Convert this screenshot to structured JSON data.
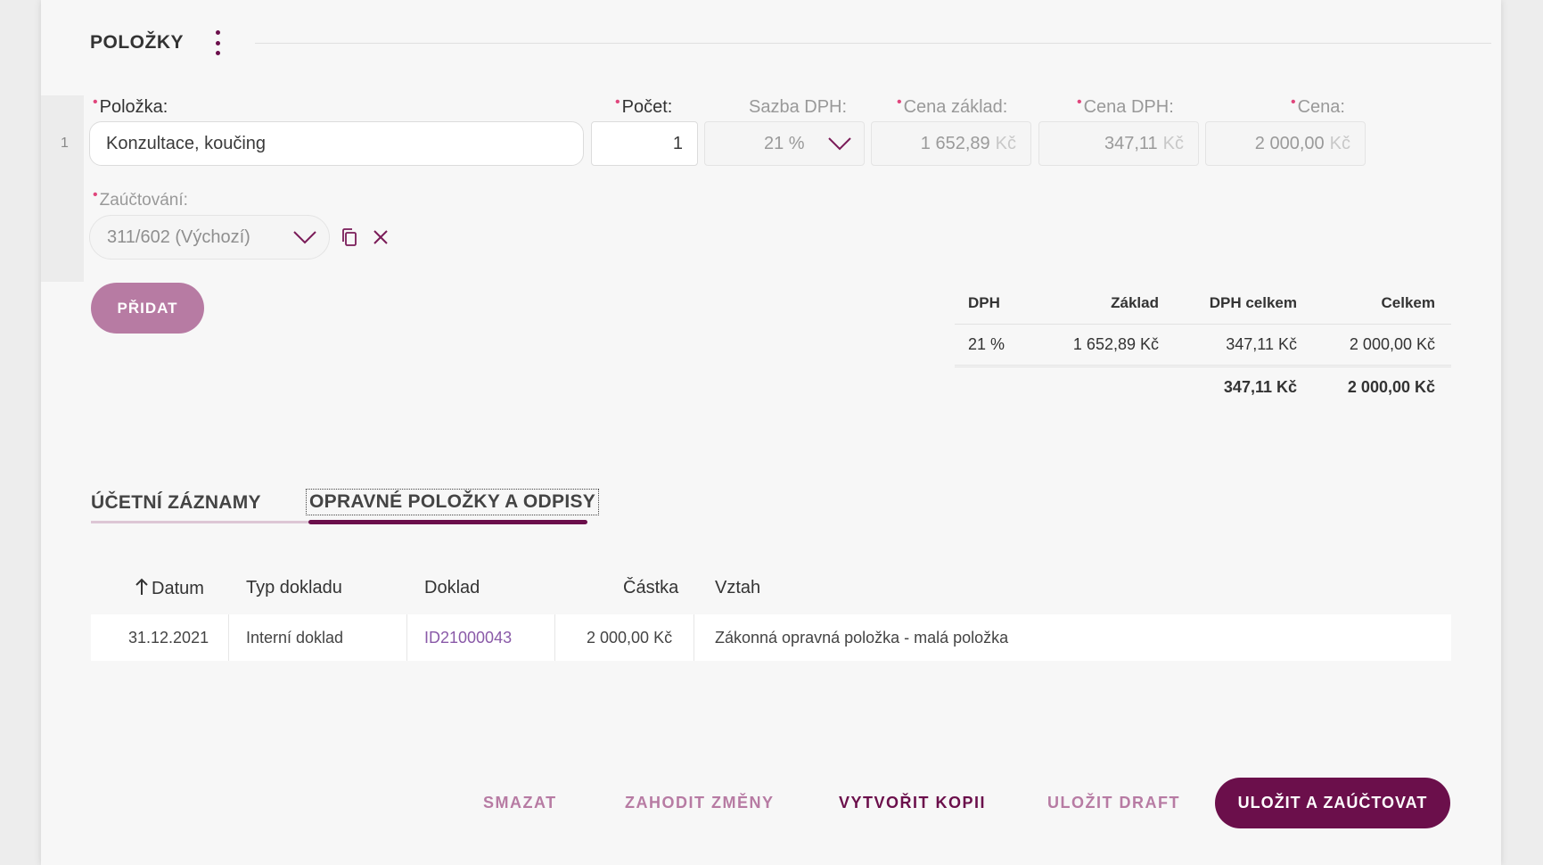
{
  "section": {
    "title": "POLOŽKY"
  },
  "row": {
    "number": "1",
    "item_label": "Položka:",
    "item_value": "Konzultace, koučing",
    "qty_label": "Počet:",
    "qty_value": "1",
    "vat_rate_label": "Sazba DPH:",
    "vat_rate_value": "21 %",
    "base_price_label": "Cena základ:",
    "base_price_value": "1 652,89",
    "vat_price_label": "Cena DPH:",
    "vat_price_value": "347,11",
    "price_label": "Cena:",
    "price_value": "2 000,00",
    "currency": "Kč",
    "posting_label": "Zaúčtování:",
    "posting_value": "311/602 (Výchozí)"
  },
  "add_button": "PŘIDAT",
  "vat_summary": {
    "headers": [
      "DPH",
      "Základ",
      "DPH celkem",
      "Celkem"
    ],
    "row": [
      "21 %",
      "1 652,89 Kč",
      "347,11 Kč",
      "2 000,00 Kč"
    ],
    "totals": [
      "347,11 Kč",
      "2 000,00 Kč"
    ]
  },
  "tabs": [
    {
      "label": "ÚČETNÍ ZÁZNAMY",
      "active": false
    },
    {
      "label": "OPRAVNÉ POLOŽKY A ODPISY",
      "active": true
    }
  ],
  "grid": {
    "headers": [
      "Datum",
      "Typ dokladu",
      "Doklad",
      "Částka",
      "Vztah"
    ],
    "rows": [
      [
        "31.12.2021",
        "Interní doklad",
        "ID21000043",
        "2 000,00 Kč",
        "Zákonná opravná položka - malá položka"
      ]
    ]
  },
  "footer": {
    "delete": "SMAZAT",
    "discard": "ZAHODIT ZMĚNY",
    "copy": "VYTVOŘIT KOPII",
    "draft": "ULOŽIT DRAFT",
    "save": "ULOŽIT A ZAÚČTOVAT"
  },
  "colors": {
    "accent": "#6b0f4b",
    "accent_light": "#b77ba3",
    "required": "#e0467c",
    "link": "#8a5aa8"
  }
}
